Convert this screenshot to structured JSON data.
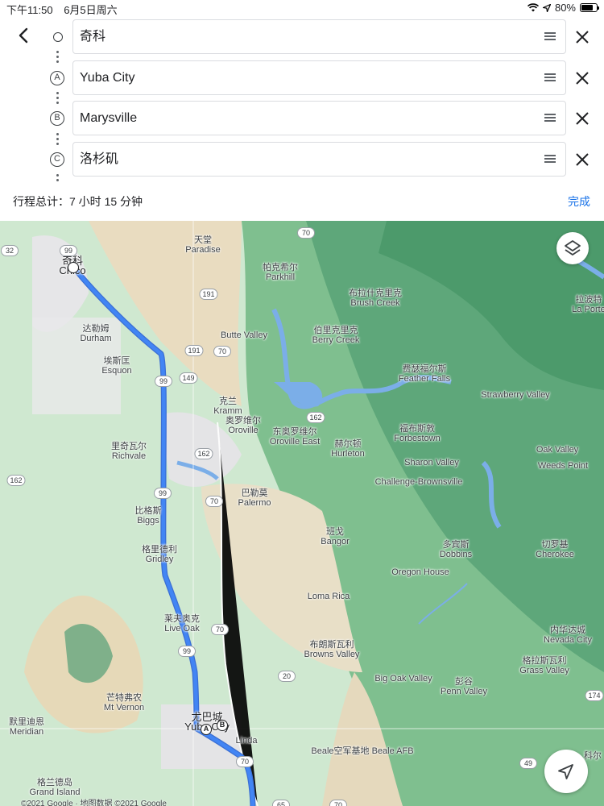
{
  "status_bar": {
    "time": "下午11:50",
    "date": "6月5日周六",
    "battery": "80%",
    "battery_level": 0.8
  },
  "directions": {
    "stops": [
      {
        "marker": "",
        "value": "奇科"
      },
      {
        "marker": "A",
        "value": "Yuba City"
      },
      {
        "marker": "B",
        "value": "Marysville"
      },
      {
        "marker": "C",
        "value": "洛杉矶"
      }
    ],
    "summary": "行程总计：7 小时 15 分钟",
    "done_label": "完成"
  },
  "map": {
    "route_color": "#4285f4",
    "water_color": "#7baee8",
    "places": [
      {
        "zh": "奇科",
        "en": "Chico",
        "major": true
      },
      {
        "zh": "天堂",
        "en": "Paradise"
      },
      {
        "zh": "帕克希尔",
        "en": "Parkhill"
      },
      {
        "zh": "布拉什克里克",
        "en": "Brush Creek"
      },
      {
        "zh": "拉波特",
        "en": "La Porte"
      },
      {
        "zh": "达勒姆",
        "en": "Durham"
      },
      {
        "zh": "",
        "en": "Butte Valley"
      },
      {
        "zh": "伯里克里克",
        "en": "Berry Creek"
      },
      {
        "zh": "埃斯匡",
        "en": "Esquon"
      },
      {
        "zh": "费瑟福尔斯",
        "en": "Feather Falls"
      },
      {
        "zh": "",
        "en": "Strawberry Valley"
      },
      {
        "zh": "克兰",
        "en": "Kramm"
      },
      {
        "zh": "奥罗维尔",
        "en": "Oroville"
      },
      {
        "zh": "东奥罗维尔",
        "en": "Oroville East"
      },
      {
        "zh": "福布斯敦",
        "en": "Forbestown"
      },
      {
        "zh": "赫尔顿",
        "en": "Hurleton"
      },
      {
        "zh": "里奇瓦尔",
        "en": "Richvale"
      },
      {
        "zh": "",
        "en": "Sharon Valley"
      },
      {
        "zh": "",
        "en": "Oak Valley"
      },
      {
        "zh": "",
        "en": "Weeds Point"
      },
      {
        "zh": "",
        "en": "Challenge-Brownsville"
      },
      {
        "zh": "巴勒莫",
        "en": "Palermo"
      },
      {
        "zh": "比格斯",
        "en": "Biggs"
      },
      {
        "zh": "班戈",
        "en": "Bangor"
      },
      {
        "zh": "多宾斯",
        "en": "Dobbins"
      },
      {
        "zh": "切罗基",
        "en": "Cherokee"
      },
      {
        "zh": "格里德利",
        "en": "Gridley"
      },
      {
        "zh": "",
        "en": "Oregon House"
      },
      {
        "zh": "",
        "en": "Loma Rica"
      },
      {
        "zh": "莱夫奥克",
        "en": "Live Oak"
      },
      {
        "zh": "内华达城",
        "en": "Nevada City"
      },
      {
        "zh": "布朗斯瓦利",
        "en": "Browns Valley"
      },
      {
        "zh": "格拉斯瓦利",
        "en": "Grass Valley"
      },
      {
        "zh": "",
        "en": "Big Oak Valley"
      },
      {
        "zh": "彭谷",
        "en": "Penn Valley"
      },
      {
        "zh": "芒特弗农",
        "en": "Mt Vernon"
      },
      {
        "zh": "默里迪恩",
        "en": "Meridian"
      },
      {
        "zh": "尤巴城",
        "en": "Yuba City",
        "major": true
      },
      {
        "zh": "",
        "en": "Linda"
      },
      {
        "zh": "",
        "en": "Beale空军基地 Beale AFB"
      },
      {
        "zh": "格兰德岛",
        "en": "Grand Island"
      },
      {
        "zh": "科尔",
        "en": ""
      }
    ],
    "shields": [
      "32",
      "99",
      "70",
      "191",
      "191",
      "70",
      "99",
      "149",
      "162",
      "162",
      "162",
      "99",
      "70",
      "70",
      "99",
      "20",
      "174",
      "49",
      "70",
      "65",
      "70"
    ],
    "attribution": "©2021 Google · 地图数据 ©2021 Google",
    "layers_icon": "layers-icon",
    "locate_icon": "navigation-arrow-icon"
  }
}
